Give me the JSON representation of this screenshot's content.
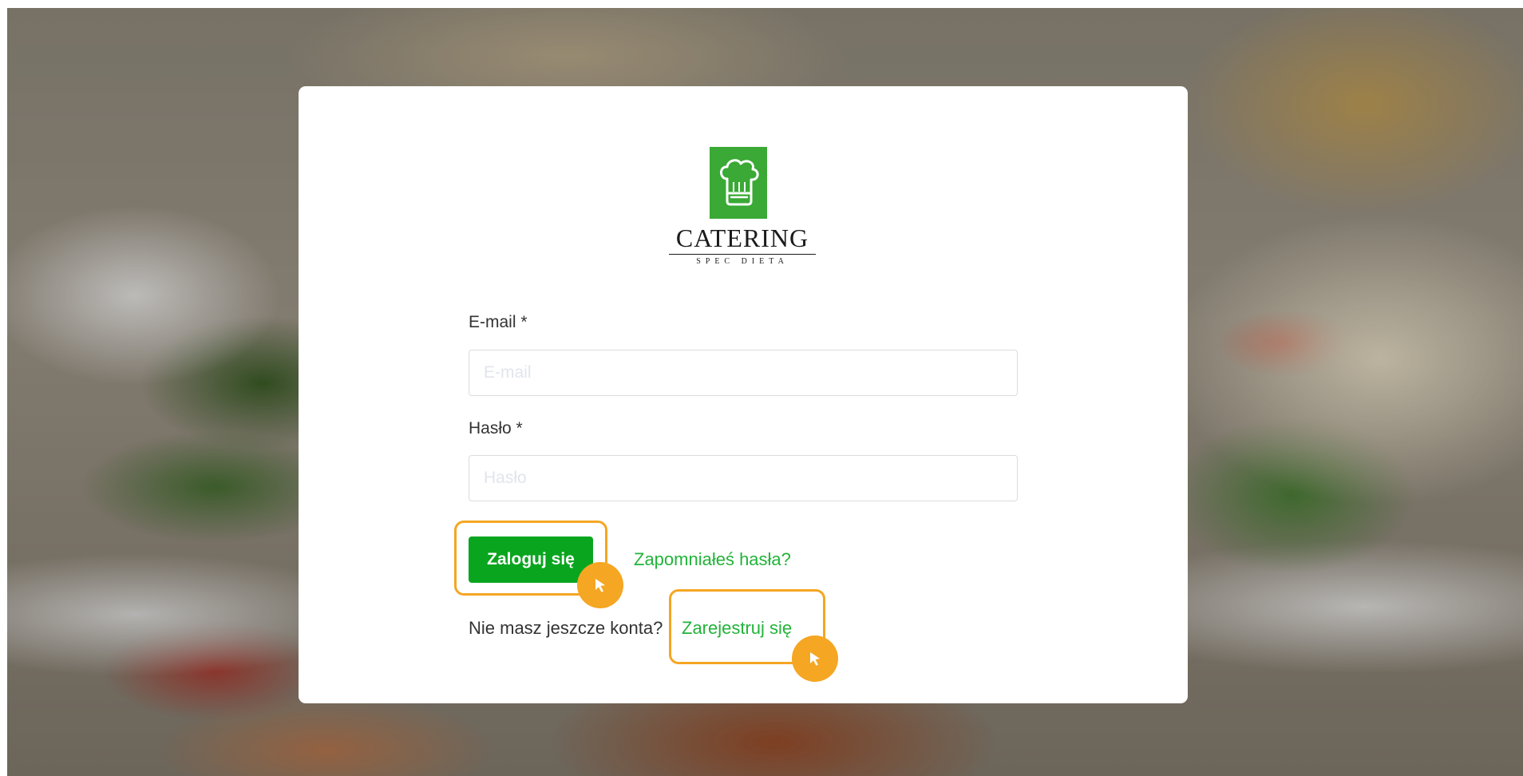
{
  "brand": {
    "name": "CATERING",
    "tagline": "SPEC DIETA",
    "logo_icon": "chef-hat-icon",
    "accent_color": "#3aa935"
  },
  "form": {
    "email_label": "E-mail *",
    "email_placeholder": "E-mail",
    "email_value": "",
    "password_label": "Hasło *",
    "password_placeholder": "Hasło",
    "password_value": "",
    "login_button": "Zaloguj się",
    "forgot_link": "Zapomniałeś hasła?",
    "register_prompt": "Nie masz jeszcze konta?",
    "register_link": "Zarejestruj się"
  },
  "colors": {
    "button_green": "#0aa51f",
    "link_green": "#22b33a",
    "highlight_orange": "#f5a623"
  },
  "highlights": [
    {
      "target": "login-button",
      "icon": "cursor-icon"
    },
    {
      "target": "register-link",
      "icon": "cursor-icon"
    }
  ]
}
